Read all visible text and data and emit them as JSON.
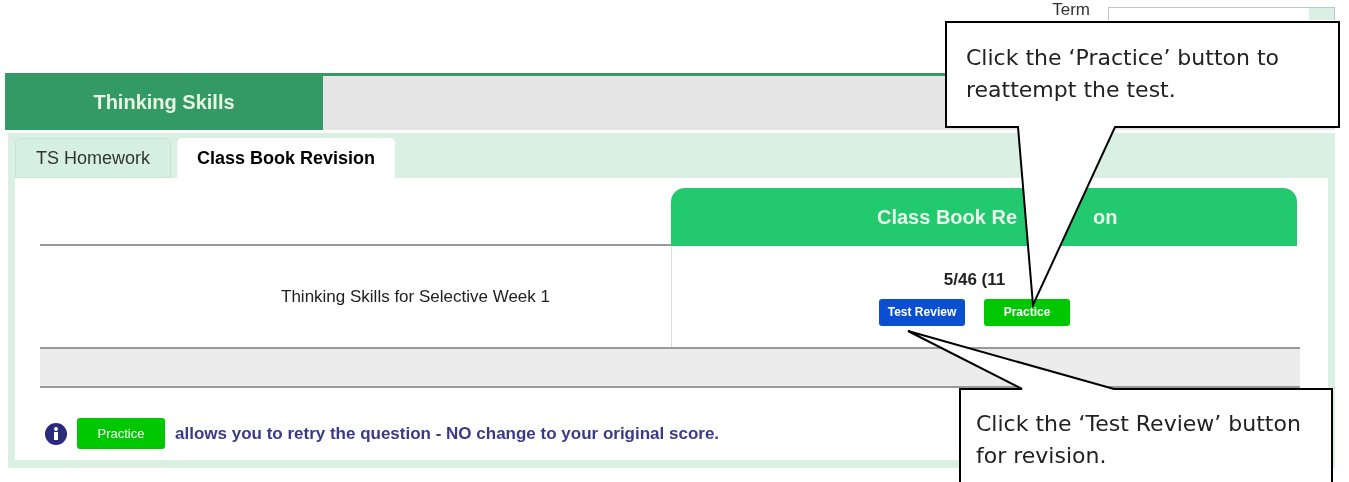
{
  "term": {
    "label": "Term"
  },
  "subject_tab": {
    "label": "Thinking Skills",
    "selected": true
  },
  "tabs": [
    {
      "label": "TS Homework",
      "selected": false
    },
    {
      "label": "Class Book Revision",
      "selected": true
    }
  ],
  "table": {
    "header": [
      "Class Book Re",
      "on"
    ],
    "rows": [
      {
        "title": "Thinking Skills for Selective Week 1",
        "score": "5/46 (11",
        "buttons": [
          {
            "label": "Test Review",
            "kind": "review"
          },
          {
            "label": "Practice",
            "kind": "practice"
          }
        ]
      }
    ]
  },
  "note": {
    "button": "Practice",
    "text": "allows you to retry the question - NO change to your original score."
  },
  "callouts": [
    {
      "text": "Click the ‘Practice’ button to reattempt the test."
    },
    {
      "text": "Click the ‘Test Review’ button for revision."
    }
  ]
}
